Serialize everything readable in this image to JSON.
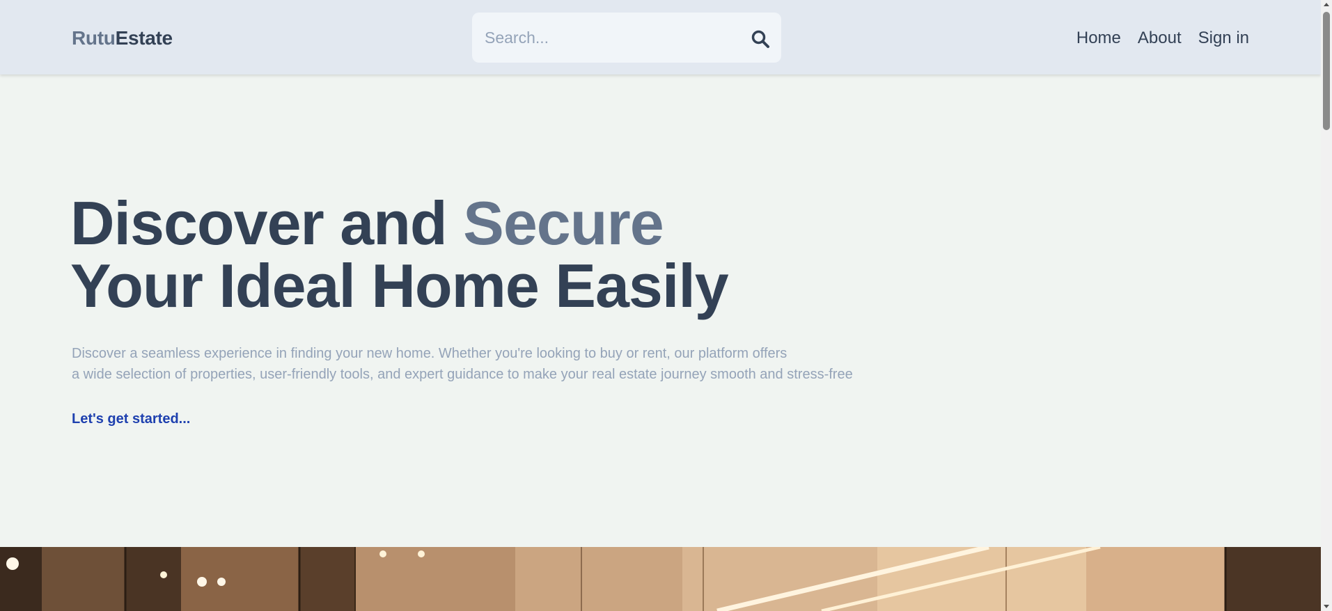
{
  "header": {
    "logo": {
      "part1": "Rutu",
      "part2": "Estate"
    },
    "search": {
      "placeholder": "Search...",
      "value": ""
    },
    "nav": {
      "home": "Home",
      "about": "About",
      "sign_in": "Sign in"
    }
  },
  "hero": {
    "title_line1_a": "Discover and ",
    "title_line1_accent": "Secure",
    "title_line2": "Your Ideal Home Easily",
    "desc_line1": "Discover a seamless experience in finding your new home. Whether you're looking to buy or rent, our platform offers",
    "desc_line2": "a wide selection of properties, user-friendly tools, and expert guidance to make your real estate journey smooth and stress-free",
    "cta": "Let's get started..."
  },
  "colors": {
    "header_bg": "#e2e8f0",
    "page_bg": "#f0f4f1",
    "primary_text": "#334155",
    "accent_text": "#64748b",
    "muted_text": "#94a3b8",
    "link": "#1e40af"
  },
  "icons": {
    "search": "search-icon"
  }
}
